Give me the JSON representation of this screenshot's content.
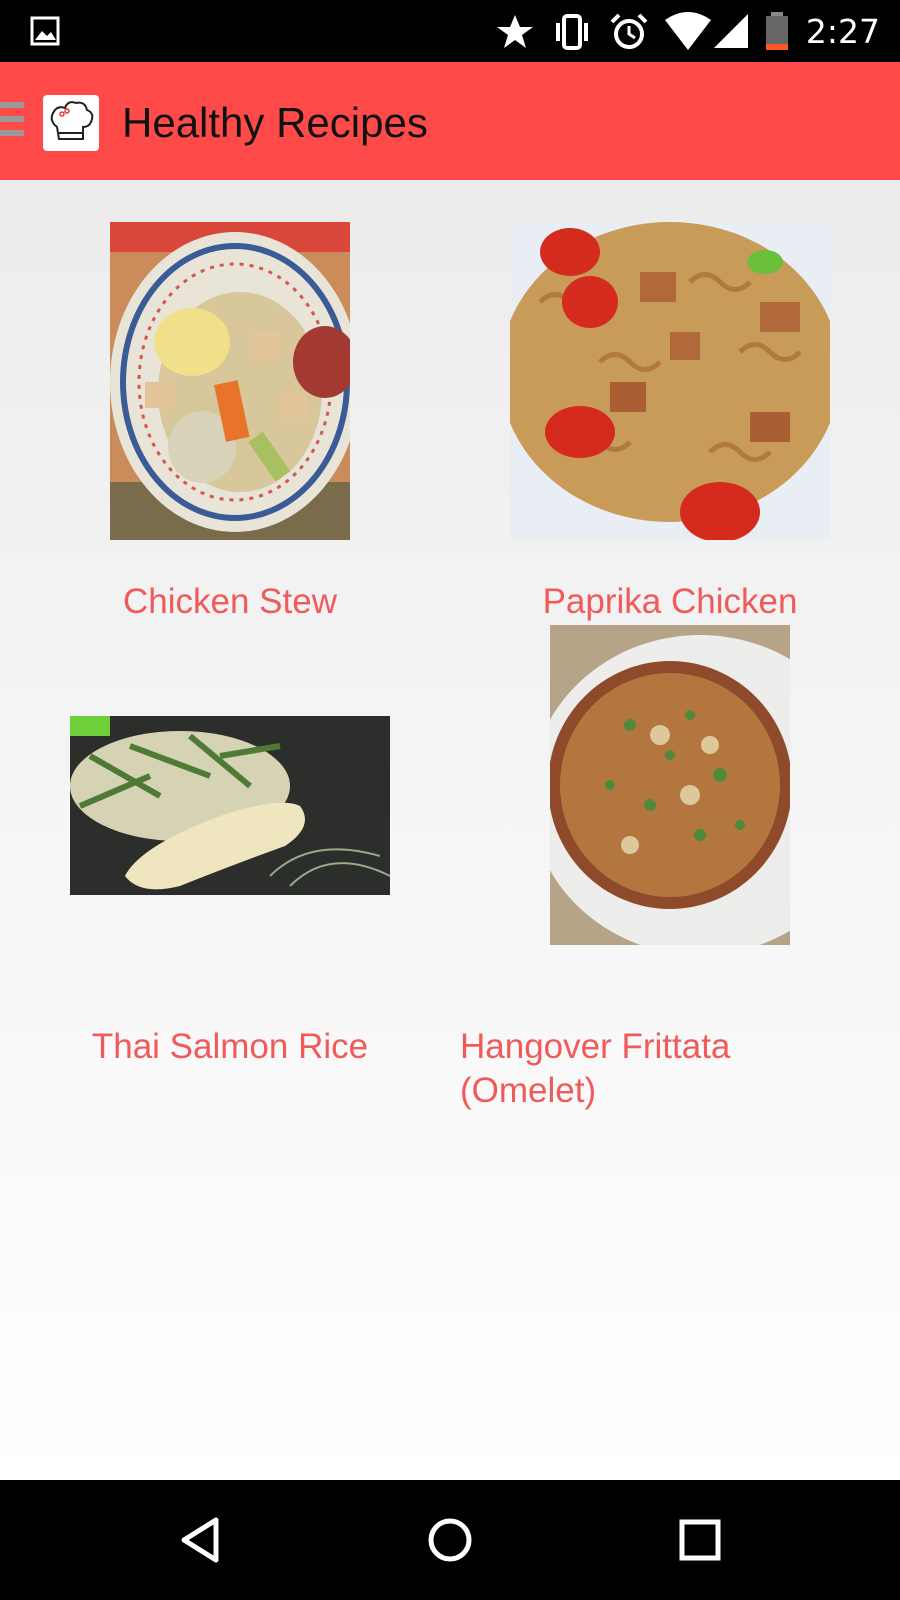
{
  "status_bar": {
    "time": "2:27",
    "icons": [
      "gallery-icon",
      "star-icon",
      "vibrate-icon",
      "alarm-icon",
      "wifi-icon",
      "signal-icon",
      "battery-icon"
    ]
  },
  "app_bar": {
    "title": "Healthy Recipes",
    "logo": "chef-hat-icon",
    "menu": "hamburger-icon",
    "color": "#ff4a4a"
  },
  "recipes": [
    {
      "name": "Chicken Stew"
    },
    {
      "name": "Paprika Chicken"
    },
    {
      "name": "Thai Salmon Rice"
    },
    {
      "name": "Hangover Frittata\n(Omelet)"
    }
  ],
  "colors": {
    "label": "#f05a5a",
    "app_bar": "#ff4a4a"
  },
  "nav_bar": {
    "icons": [
      "back-icon",
      "home-icon",
      "recents-icon"
    ]
  }
}
